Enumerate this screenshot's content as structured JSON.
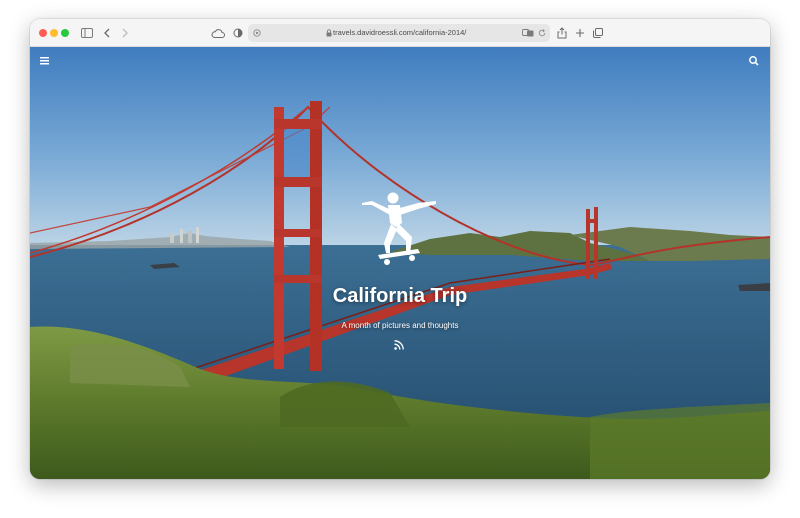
{
  "browser": {
    "url": "travels.davidroessli.com/california-2014/",
    "icons": {
      "sidebar": "sidebar-icon",
      "back": "chevron-left-icon",
      "forward": "chevron-right-icon",
      "icloud": "cloud-icon",
      "privacy": "shield-half-icon",
      "site_settings": "gear-icon",
      "lock": "lock-icon",
      "translate": "translate-icon",
      "reload": "reload-icon",
      "share": "share-icon",
      "new_tab": "plus-icon",
      "tabs": "tabs-overview-icon"
    },
    "traffic_colors": [
      "#ff5f57",
      "#febc2e",
      "#28c840"
    ]
  },
  "page": {
    "title": "California Trip",
    "subtitle": "A month of pictures and thoughts",
    "icons": {
      "menu": "hamburger-menu-icon",
      "search": "search-icon",
      "logo": "skateboarder-logo-icon",
      "feed": "rss-icon"
    },
    "colors": {
      "text": "#ffffff",
      "bridge": "#c1352b",
      "sky": "#4a86c6",
      "water": "#2f5a7a",
      "grass": "#6f8a3a"
    }
  }
}
